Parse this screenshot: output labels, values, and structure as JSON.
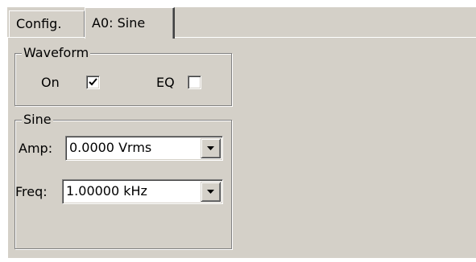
{
  "tabs": [
    {
      "label": "Config."
    },
    {
      "label": "A0: Sine"
    }
  ],
  "waveform": {
    "legend": "Waveform",
    "on_label": "On",
    "on_checked": true,
    "eq_label": "EQ",
    "eq_checked": false
  },
  "sine": {
    "legend": "Sine",
    "amp_label": "Amp:",
    "amp_value": "0.0000 Vrms",
    "freq_label": "Freq:",
    "freq_value": "1.00000 kHz"
  },
  "icons": {
    "checkmark": "check-icon",
    "dropdown": "chevron-down-icon"
  },
  "colors": {
    "face": "#d4d0c8",
    "shadow": "#808080",
    "highlight": "#ffffff"
  }
}
